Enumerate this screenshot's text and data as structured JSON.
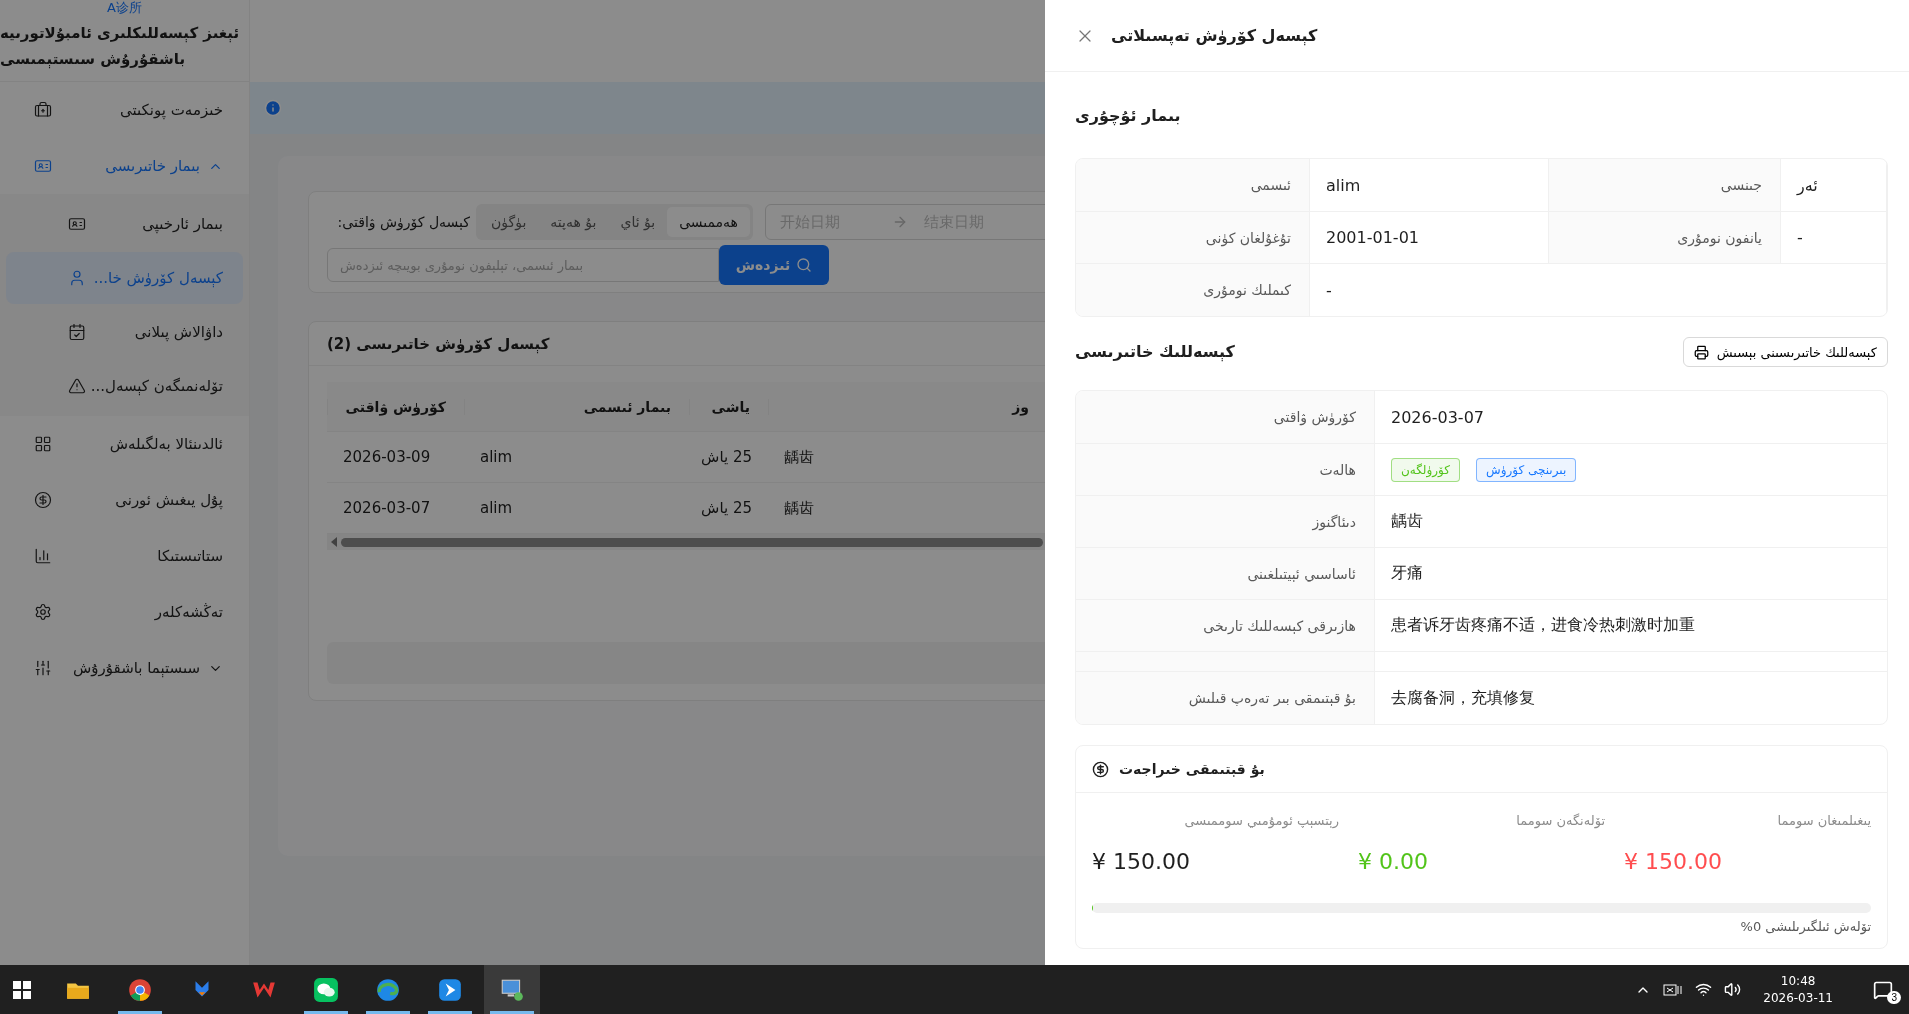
{
  "app": {
    "logo": "A诊所",
    "title": "ئېغىز كېسەللىكلىرى ئامبۇلاتورىيە باشقۇرۇش سىستېمىسى"
  },
  "sidebar": {
    "items": [
      {
        "label": "خىزمەت پونكىتى",
        "selected": false
      },
      {
        "label": "بىمار خاتىرىسى",
        "selected": true,
        "expanded": true,
        "children": [
          {
            "label": "بىمار ئارخىپى",
            "selected": false
          },
          {
            "label": "كېسەل كۆرۈش خا...",
            "selected": true
          },
          {
            "label": "داۋالاش پىلانى",
            "selected": false
          },
          {
            "label": "تۆلەنمىگەن كېسەل...",
            "selected": false
          }
        ]
      },
      {
        "label": "ئالدىنئالا بەلگىلەش",
        "selected": false
      },
      {
        "label": "پۇل يىغىش ئورنى",
        "selected": false
      },
      {
        "label": "ستاتىستىكا",
        "selected": false
      },
      {
        "label": "تەڭشەكلەر",
        "selected": false
      },
      {
        "label": "سىستېما باشقۇرۇش",
        "selected": false,
        "expanded": false
      }
    ]
  },
  "filter": {
    "label": "كېسەل كۆرۈش ۋاقتى:",
    "ranges": [
      {
        "label": "ھەممىسى",
        "selected": true
      },
      {
        "label": "بۇ ئاي",
        "selected": false
      },
      {
        "label": "بۇ ھەپتە",
        "selected": false
      },
      {
        "label": "بۈگۈن",
        "selected": false
      }
    ],
    "date_start": {
      "placeholder": "开始日期"
    },
    "date_end": {
      "placeholder": "结束日期"
    },
    "search": {
      "placeholder": "بىمار ئىسمى، تېلېفون نومۇرى بويىچە ئىزدەش"
    },
    "search_button": "ئىزدەش"
  },
  "table": {
    "title": "كېسەل كۆرۈش خاتىرىسى (2)",
    "columns": [
      "وز",
      "ياشى",
      "بىمار ئىسمى",
      "كۆرۈش ۋاقتى"
    ],
    "rows": [
      [
        "龋齿",
        "25 ياش",
        "alim",
        "2026-03-09"
      ],
      [
        "龋齿",
        "25 ياش",
        "alim",
        "2026-03-07"
      ]
    ]
  },
  "drawer": {
    "title": "كېسەل كۆرۈش تەپسىلاتى",
    "patient": {
      "title": "بىمار ئۇچۇرى",
      "fields": [
        {
          "label": "جىنسى",
          "value": "ئەر"
        },
        {
          "label": "ئىسمى",
          "value": "alim"
        },
        {
          "label": "يانفون نومۇرى",
          "value": "-"
        },
        {
          "label": "تۇغۇلغان كۈنى",
          "value": "2001-01-01"
        },
        {
          "label": "كىملىك نومۇرى",
          "value": "-"
        }
      ]
    },
    "record": {
      "title": "كېسەللىك خاتىرىسى",
      "print_button": "كېسەللىك خاتىرىسىنى بېسىش",
      "rows": [
        {
          "kind": "text",
          "label": "كۆرۈش ۋاقتى",
          "value": "2026-03-07"
        },
        {
          "kind": "tags",
          "label": "ھالەت",
          "tags": [
            {
              "label": "بىرىنچى كۆرۈش",
              "color": "#1677ff"
            },
            {
              "label": "كۆرۈلگەن",
              "color": "#52c41a"
            }
          ]
        },
        {
          "kind": "text",
          "label": "دىئاگنوز",
          "value": "龋齿"
        },
        {
          "kind": "text",
          "label": "ئاساسىي ئېيتىلغىنى",
          "value": "牙痛"
        },
        {
          "kind": "text",
          "label": "ھازىرقى كېسەللىك تارىخى",
          "value": "患者诉牙齿疼痛不适，进食冷热刺激时加重"
        },
        {
          "kind": "blank"
        },
        {
          "kind": "text",
          "label": "بۇ قېتىمقى بىر تەرەپ قىلىش",
          "value": "去腐备洞，充填修复"
        }
      ]
    },
    "fees": {
      "title": "بۇ قېتىمقى خىراجەت",
      "stats": [
        {
          "label": "يىغىلمىغان سومما",
          "value": "¥ 150.00",
          "color": "#ff4d4f"
        },
        {
          "label": "تۆلەنگەن سومما",
          "value": "¥ 0.00",
          "color": "#52c41a"
        },
        {
          "label": "رېتسېپ ئومۇمىي سوممىسى",
          "value": "¥ 150.00",
          "color": "#1f1f1f"
        }
      ],
      "progress": {
        "level": 0,
        "label": "تۆلەش ئىلگىرىلىشى 0%"
      }
    }
  },
  "taskbar": {
    "apps": [
      {
        "running": false,
        "selected": false
      },
      {
        "running": true,
        "selected": false
      },
      {
        "running": false,
        "selected": false
      },
      {
        "running": false,
        "selected": false
      },
      {
        "running": true,
        "selected": false
      },
      {
        "running": true,
        "selected": false
      },
      {
        "running": true,
        "selected": false
      },
      {
        "running": true,
        "selected": true
      }
    ],
    "time": "10:48",
    "date": "2026-03-11",
    "notifications": "3"
  }
}
